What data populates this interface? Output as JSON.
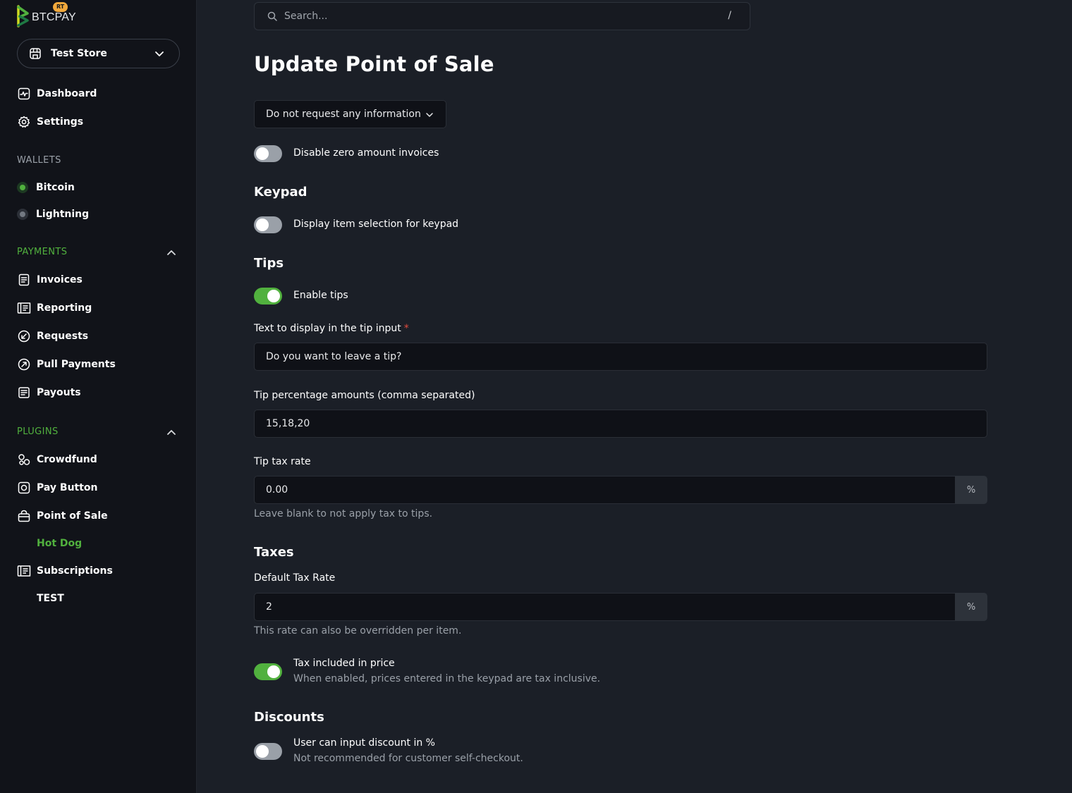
{
  "brand": {
    "name": "BTCPAY",
    "badge": "RT",
    "green": "#51b13e",
    "accent": "#f2a93b"
  },
  "store": {
    "name": "Test Store",
    "icon": "store-icon"
  },
  "nav": {
    "dashboard": "Dashboard",
    "settings": "Settings",
    "wallets_title": "WALLETS",
    "bitcoin": "Bitcoin",
    "lightning": "Lightning",
    "payments_title": "PAYMENTS",
    "invoices": "Invoices",
    "reporting": "Reporting",
    "requests": "Requests",
    "pull_payments": "Pull Payments",
    "payouts": "Payouts",
    "plugins_title": "PLUGINS",
    "crowdfund": "Crowdfund",
    "pay_button": "Pay Button",
    "point_of_sale": "Point of Sale",
    "hot_dog": "Hot Dog",
    "subscriptions": "Subscriptions",
    "test": "TEST"
  },
  "search": {
    "placeholder": "Search...",
    "shortcut": "/"
  },
  "page": {
    "title": "Update Point of Sale",
    "request_info_select": "Do not request any information",
    "disable_zero": {
      "label": "Disable zero amount invoices",
      "on": false
    },
    "keypad": {
      "title": "Keypad",
      "display_item_selection": {
        "label": "Display item selection for keypad",
        "on": false
      }
    },
    "tips": {
      "title": "Tips",
      "enable_tips": {
        "label": "Enable tips",
        "on": true
      },
      "tip_text_label": "Text to display in the tip input",
      "required_mark": "*",
      "tip_text_value": "Do you want to leave a tip?",
      "tip_pct_label": "Tip percentage amounts (comma separated)",
      "tip_pct_value": "15,18,20",
      "tip_tax_label": "Tip tax rate",
      "tip_tax_value": "0.00",
      "tip_tax_unit": "%",
      "tip_tax_help": "Leave blank to not apply tax to tips."
    },
    "taxes": {
      "title": "Taxes",
      "default_tax_label": "Default Tax Rate",
      "default_tax_value": "2",
      "default_tax_unit": "%",
      "default_tax_help": "This rate can also be overridden per item.",
      "tax_included": {
        "label": "Tax included in price",
        "desc": "When enabled, prices entered in the keypad are tax inclusive.",
        "on": true
      }
    },
    "discounts": {
      "title": "Discounts",
      "user_discount": {
        "label": "User can input discount in %",
        "desc": "Not recommended for customer self-checkout.",
        "on": false
      }
    }
  }
}
